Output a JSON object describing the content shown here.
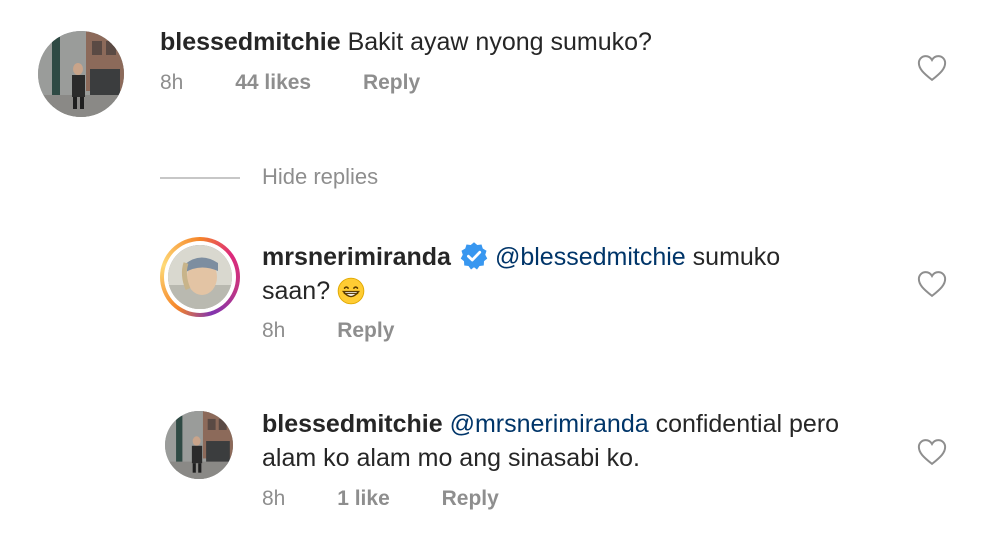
{
  "comments": [
    {
      "username": "blessedmitchie",
      "mention": "",
      "text": "Bakit ayaw nyong sumuko?",
      "time": "8h",
      "likes": "44 likes",
      "reply": "Reply"
    },
    {
      "username": "mrsnerimiranda",
      "mention": "@blessedmitchie",
      "text_line1": " sumuko",
      "text_line2": "saan? ",
      "emoji": "grinning-face-with-smiling-eyes",
      "time": "8h",
      "reply": "Reply",
      "verified": true
    },
    {
      "username": "blessedmitchie",
      "mention": "@mrsnerimiranda",
      "text_line1": " confidential pero",
      "text_line2": "alam ko alam mo ang sinasabi ko.",
      "time": "8h",
      "likes": "1 like",
      "reply": "Reply"
    }
  ],
  "hide_replies": "Hide replies",
  "colors": {
    "text": "#262626",
    "meta": "#8e8e8e",
    "mention": "#003569",
    "verified": "#3897f0"
  },
  "icons": {
    "like": "heart-outline-icon",
    "verified": "verified-badge-icon"
  }
}
